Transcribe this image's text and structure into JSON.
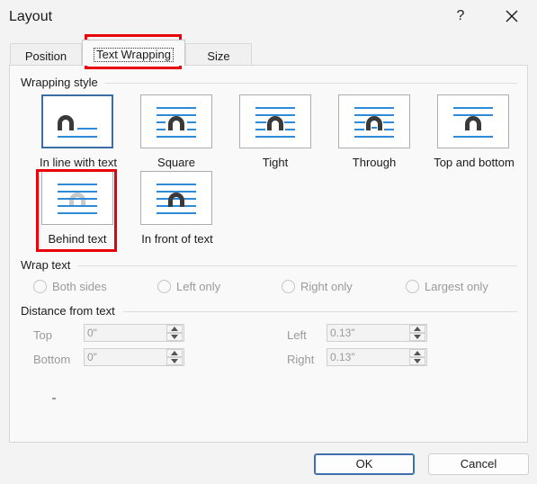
{
  "dialog": {
    "title": "Layout",
    "help_label": "?",
    "close_icon": "close-icon"
  },
  "tabs": [
    {
      "label": "Position",
      "active": false
    },
    {
      "label": "Text Wrapping",
      "active": true
    },
    {
      "label": "Size",
      "active": false
    }
  ],
  "wrapping_style": {
    "heading": "Wrapping style",
    "options": [
      {
        "label": "In line with text",
        "selected": true
      },
      {
        "label": "Square",
        "selected": false
      },
      {
        "label": "Tight",
        "selected": false
      },
      {
        "label": "Through",
        "selected": false
      },
      {
        "label": "Top and bottom",
        "selected": false
      },
      {
        "label": "Behind text",
        "selected": false
      },
      {
        "label": "In front of text",
        "selected": false
      }
    ]
  },
  "wrap_text": {
    "heading": "Wrap text",
    "options": [
      {
        "label": "Both sides"
      },
      {
        "label": "Left only"
      },
      {
        "label": "Right only"
      },
      {
        "label": "Largest only"
      }
    ]
  },
  "distance": {
    "heading": "Distance from text",
    "top": {
      "label": "Top",
      "value": "0\""
    },
    "bottom": {
      "label": "Bottom",
      "value": "0\""
    },
    "left": {
      "label": "Left",
      "value": "0.13\""
    },
    "right": {
      "label": "Right",
      "value": "0.13\""
    }
  },
  "footer": {
    "ok_label": "OK",
    "cancel_label": "Cancel"
  },
  "colors": {
    "accent_blue": "#2e8bd8",
    "highlight_red": "#e8000b",
    "selected_border": "#3a6ea5"
  }
}
